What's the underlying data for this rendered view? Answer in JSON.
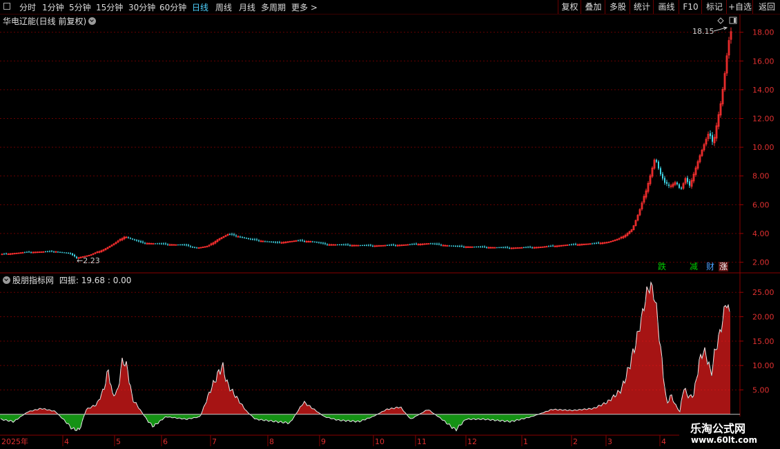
{
  "toolbar": {
    "periods": [
      {
        "label": "分时",
        "x": 28,
        "active": false
      },
      {
        "label": "1分钟",
        "x": 61,
        "active": false
      },
      {
        "label": "5分钟",
        "x": 100,
        "active": false
      },
      {
        "label": "15分钟",
        "x": 139,
        "active": false
      },
      {
        "label": "30分钟",
        "x": 186,
        "active": false
      },
      {
        "label": "60分钟",
        "x": 231,
        "active": false
      },
      {
        "label": "日线",
        "x": 278,
        "active": true
      },
      {
        "label": "周线",
        "x": 312,
        "active": false
      },
      {
        "label": "月线",
        "x": 346,
        "active": false
      },
      {
        "label": "多周期",
        "x": 378,
        "active": false
      },
      {
        "label": "更多 >",
        "x": 422,
        "active": false
      }
    ],
    "right_buttons": [
      "复权",
      "叠加",
      "多股",
      "统计",
      "画线",
      "F10",
      "标记",
      "+自选",
      "返回"
    ]
  },
  "main_chart": {
    "title": "华电辽能(日线 前复权)",
    "high_label": "18.15",
    "low_label": "2.23",
    "y_ticks": [
      "18.00",
      "16.00",
      "14.00",
      "12.00",
      "10.00",
      "8.00",
      "6.00",
      "4.00",
      "2.00"
    ],
    "badges": [
      {
        "text": "跌",
        "color": "#00d000"
      },
      {
        "text": "减",
        "color": "#00d000"
      },
      {
        "text": "财",
        "color": "#4aa0ff"
      },
      {
        "text": "涨",
        "color": "#ff4040"
      }
    ]
  },
  "indicator": {
    "name": "股朋指标网",
    "label": "四振: 19.68 : 0.00",
    "y_ticks": [
      "25.00",
      "20.00",
      "15.00",
      "10.00",
      "5.00"
    ]
  },
  "x_axis": {
    "labels": [
      "2025年",
      "4",
      "5",
      "6",
      "7",
      "8",
      "9",
      "10",
      "11",
      "12",
      "1",
      "2",
      "3",
      "4"
    ]
  },
  "watermark": {
    "line1": "乐淘公式网",
    "line2": "www.60lt.com"
  },
  "chart_data": {
    "type": "candlestick",
    "price_ylim": [
      1.5,
      18.8
    ],
    "indicator_ylim": [
      -4,
      28
    ],
    "control_points": [
      [
        0,
        2.55
      ],
      [
        40,
        2.7
      ],
      [
        80,
        2.75
      ],
      [
        100,
        2.6
      ],
      [
        110,
        2.3
      ],
      [
        130,
        2.5
      ],
      [
        150,
        2.9
      ],
      [
        165,
        3.3
      ],
      [
        180,
        3.8
      ],
      [
        190,
        3.6
      ],
      [
        205,
        3.35
      ],
      [
        240,
        3.25
      ],
      [
        265,
        3.2
      ],
      [
        285,
        3.0
      ],
      [
        300,
        3.1
      ],
      [
        315,
        3.6
      ],
      [
        330,
        3.95
      ],
      [
        345,
        3.8
      ],
      [
        360,
        3.6
      ],
      [
        400,
        3.35
      ],
      [
        430,
        3.5
      ],
      [
        450,
        3.45
      ],
      [
        470,
        3.25
      ],
      [
        500,
        3.2
      ],
      [
        540,
        3.15
      ],
      [
        580,
        3.2
      ],
      [
        620,
        3.3
      ],
      [
        660,
        3.1
      ],
      [
        700,
        3.05
      ],
      [
        740,
        3.0
      ],
      [
        780,
        3.05
      ],
      [
        820,
        3.2
      ],
      [
        860,
        3.3
      ],
      [
        880,
        3.4
      ],
      [
        895,
        3.6
      ],
      [
        905,
        3.9
      ],
      [
        915,
        4.3
      ],
      [
        925,
        5.5
      ],
      [
        935,
        7.0
      ],
      [
        942,
        8.2
      ],
      [
        948,
        9.3
      ],
      [
        955,
        8.2
      ],
      [
        962,
        7.5
      ],
      [
        970,
        7.3
      ],
      [
        978,
        7.6
      ],
      [
        985,
        7.0
      ],
      [
        992,
        7.8
      ],
      [
        998,
        7.3
      ],
      [
        1005,
        8.3
      ],
      [
        1012,
        9.3
      ],
      [
        1020,
        10.3
      ],
      [
        1026,
        11.0
      ],
      [
        1032,
        10.2
      ],
      [
        1038,
        11.8
      ],
      [
        1044,
        13.3
      ],
      [
        1050,
        15.5
      ],
      [
        1054,
        17.2
      ],
      [
        1058,
        18.0
      ]
    ],
    "osc_control_points": [
      [
        0,
        -1
      ],
      [
        20,
        -1.5
      ],
      [
        40,
        0.5
      ],
      [
        60,
        1.2
      ],
      [
        80,
        0.6
      ],
      [
        95,
        -1.5
      ],
      [
        105,
        -3
      ],
      [
        115,
        -3.2
      ],
      [
        125,
        1
      ],
      [
        140,
        2
      ],
      [
        150,
        5
      ],
      [
        157,
        9
      ],
      [
        163,
        4
      ],
      [
        170,
        4.5
      ],
      [
        178,
        11.5
      ],
      [
        185,
        9
      ],
      [
        192,
        3
      ],
      [
        198,
        2
      ],
      [
        205,
        0.5
      ],
      [
        215,
        -1.5
      ],
      [
        222,
        -2.5
      ],
      [
        240,
        -0.5
      ],
      [
        270,
        -1
      ],
      [
        290,
        -0.5
      ],
      [
        305,
        5
      ],
      [
        315,
        8
      ],
      [
        322,
        10
      ],
      [
        330,
        6
      ],
      [
        340,
        4
      ],
      [
        350,
        2
      ],
      [
        358,
        0.5
      ],
      [
        370,
        -1
      ],
      [
        400,
        -1.5
      ],
      [
        420,
        -1.8
      ],
      [
        440,
        2.5
      ],
      [
        450,
        1.5
      ],
      [
        470,
        -0.5
      ],
      [
        490,
        -1.2
      ],
      [
        520,
        -1.5
      ],
      [
        540,
        -0.5
      ],
      [
        560,
        1
      ],
      [
        580,
        1.5
      ],
      [
        595,
        -1
      ],
      [
        620,
        1
      ],
      [
        640,
        -1
      ],
      [
        660,
        -3.2
      ],
      [
        675,
        -1
      ],
      [
        700,
        -1
      ],
      [
        740,
        -1.5
      ],
      [
        770,
        -0.5
      ],
      [
        800,
        1
      ],
      [
        830,
        0.8
      ],
      [
        860,
        1.2
      ],
      [
        880,
        2.5
      ],
      [
        900,
        5
      ],
      [
        910,
        9
      ],
      [
        920,
        14
      ],
      [
        930,
        20
      ],
      [
        937,
        25
      ],
      [
        943,
        26.5
      ],
      [
        950,
        23
      ],
      [
        958,
        12
      ],
      [
        966,
        2
      ],
      [
        972,
        4
      ],
      [
        978,
        2
      ],
      [
        985,
        0.5
      ],
      [
        990,
        5.5
      ],
      [
        998,
        3.5
      ],
      [
        1005,
        4
      ],
      [
        1012,
        10
      ],
      [
        1018,
        13
      ],
      [
        1024,
        12
      ],
      [
        1030,
        8
      ],
      [
        1036,
        13
      ],
      [
        1042,
        16
      ],
      [
        1048,
        20
      ],
      [
        1052,
        23.5
      ],
      [
        1058,
        19.7
      ]
    ]
  }
}
